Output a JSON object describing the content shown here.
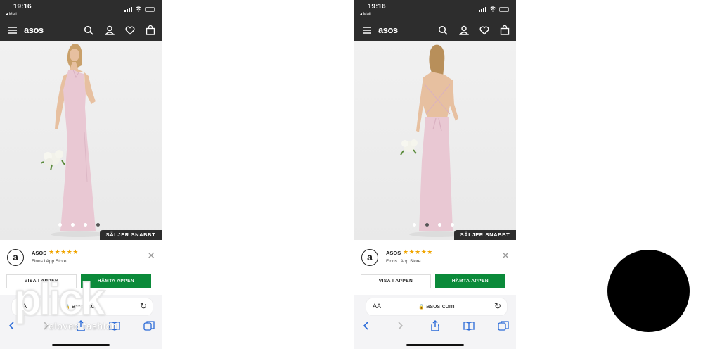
{
  "status": {
    "time": "19:16",
    "back_label": "◂ Mail"
  },
  "nav": {
    "logo": "asos"
  },
  "badge": "SÄLJER SNABBT",
  "banner": {
    "app_name": "ASOS",
    "stars": "★★★★★",
    "subtitle": "Finns i App Store",
    "view_button": "VISA I APPEN",
    "get_button": "HÄMTA APPEN"
  },
  "address": {
    "aa": "AA",
    "url": "asos.com"
  },
  "watermark": {
    "brand": "plick",
    "tagline": "reloved fashion"
  },
  "screens": [
    {
      "view": "front",
      "active_dot": 4,
      "dot_count": 4
    },
    {
      "view": "back",
      "active_dot": 2,
      "dot_count": 4
    }
  ],
  "colors": {
    "accent_green": "#0b8a3a",
    "header_dark": "#2d2d2d",
    "dress_pink": "#e9c8d3",
    "star": "#f0a500"
  }
}
